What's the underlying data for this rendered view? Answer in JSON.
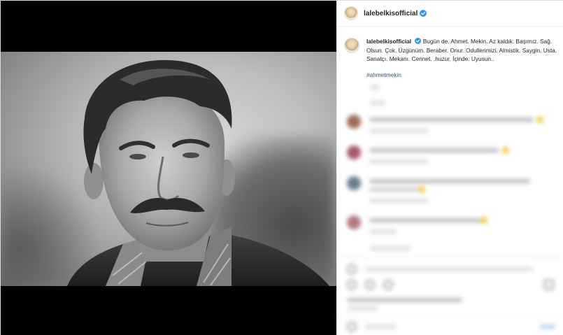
{
  "post": {
    "username": "lalebelkisofficial",
    "verified": true,
    "caption": {
      "text": "Bugün de. Ahmet. Mekin. Az kaldık. Başımız. Sağ. Olsun. Çok. Üzgünüm. Beraber. Onur. Odullerimizi. Almistik. Saygin. Usta. Sanatçı. Mekanı. Cennet. .huzur. İçinde. Uyusun..",
      "hashtag": "#ahmetmekin"
    },
    "media": {
      "description_icon": "photo-portrait"
    }
  },
  "colors": {
    "verified_blue": "#3897f0",
    "hashtag": "#385185",
    "text": "#262626"
  }
}
